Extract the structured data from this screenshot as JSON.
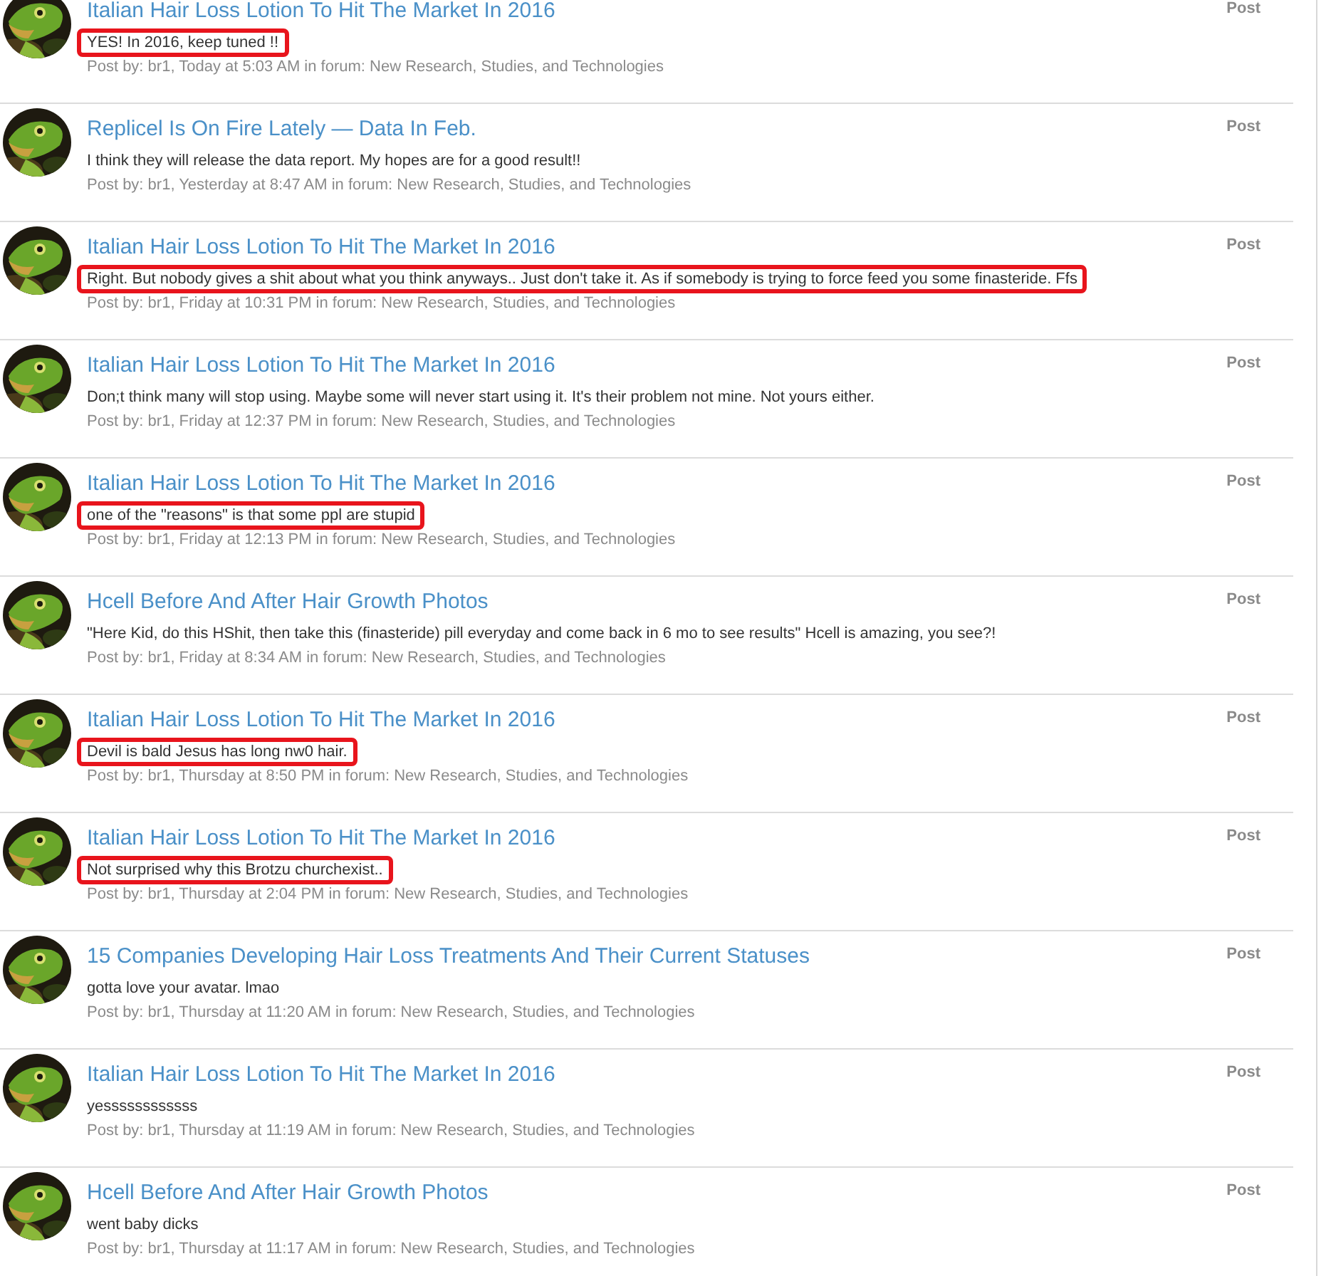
{
  "posts": [
    {
      "title": "Italian Hair Loss Lotion To Hit The Market In 2016",
      "snippet": "YES! In 2016, keep tuned !!",
      "meta": "Post by: br1, Today at 5:03 AM in forum: New Research, Studies, and Technologies",
      "type": "Post",
      "highlighted": true
    },
    {
      "title": "Replicel Is On Fire Lately — Data In Feb.",
      "snippet": "I think they will release the data report. My hopes are for a good result!!",
      "meta": "Post by: br1, Yesterday at 8:47 AM in forum: New Research, Studies, and Technologies",
      "type": "Post",
      "highlighted": false
    },
    {
      "title": "Italian Hair Loss Lotion To Hit The Market In 2016",
      "snippet": "Right. But nobody gives a shit about what you think anyways.. Just don't take it. As if somebody is trying to force feed you some finasteride. Ffs",
      "meta": "Post by: br1, Friday at 10:31 PM in forum: New Research, Studies, and Technologies",
      "type": "Post",
      "highlighted": true
    },
    {
      "title": "Italian Hair Loss Lotion To Hit The Market In 2016",
      "snippet": "Don;t think many will stop using. Maybe some will never start using it. It's their problem not mine. Not yours either.",
      "meta": "Post by: br1, Friday at 12:37 PM in forum: New Research, Studies, and Technologies",
      "type": "Post",
      "highlighted": false
    },
    {
      "title": "Italian Hair Loss Lotion To Hit The Market In 2016",
      "snippet": "one of the \"reasons\" is that some ppl are stupid",
      "meta": "Post by: br1, Friday at 12:13 PM in forum: New Research, Studies, and Technologies",
      "type": "Post",
      "highlighted": true
    },
    {
      "title": "Hcell Before And After Hair Growth Photos",
      "snippet": "\"Here Kid, do this HShit, then take this (finasteride) pill everyday and come back in 6 mo to see results\" Hcell is amazing, you see?!",
      "meta": "Post by: br1, Friday at 8:34 AM in forum: New Research, Studies, and Technologies",
      "type": "Post",
      "highlighted": false
    },
    {
      "title": "Italian Hair Loss Lotion To Hit The Market In 2016",
      "snippet": "Devil is bald Jesus has long nw0 hair.",
      "meta": "Post by: br1, Thursday at 8:50 PM in forum: New Research, Studies, and Technologies",
      "type": "Post",
      "highlighted": true
    },
    {
      "title": "Italian Hair Loss Lotion To Hit The Market In 2016",
      "snippet": "Not surprised why this Brotzu churchexist..",
      "meta": "Post by: br1, Thursday at 2:04 PM in forum: New Research, Studies, and Technologies",
      "type": "Post",
      "highlighted": true
    },
    {
      "title": "15 Companies Developing Hair Loss Treatments And Their Current Statuses",
      "snippet": "gotta love your avatar. lmao",
      "meta": "Post by: br1, Thursday at 11:20 AM in forum: New Research, Studies, and Technologies",
      "type": "Post",
      "highlighted": false
    },
    {
      "title": "Italian Hair Loss Lotion To Hit The Market In 2016",
      "snippet": "yessssssssssss",
      "meta": "Post by: br1, Thursday at 11:19 AM in forum: New Research, Studies, and Technologies",
      "type": "Post",
      "highlighted": false
    },
    {
      "title": "Hcell Before And After Hair Growth Photos",
      "snippet": "went baby dicks",
      "meta": "Post by: br1, Thursday at 11:17 AM in forum: New Research, Studies, and Technologies",
      "type": "Post",
      "highlighted": false
    }
  ]
}
